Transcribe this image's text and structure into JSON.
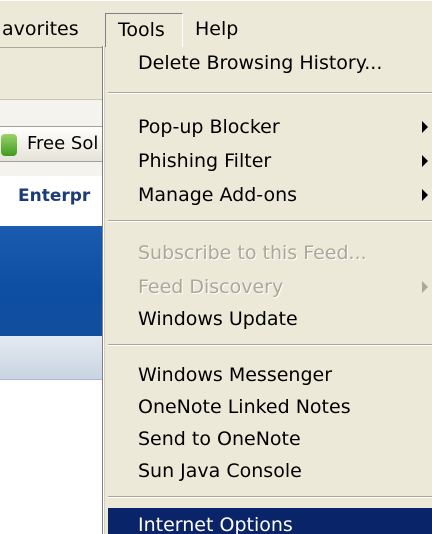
{
  "menubar": {
    "favorites_label": "avorites",
    "tools_label": "Tools",
    "help_label": "Help"
  },
  "background": {
    "toolbar_button_label": "Free Sol",
    "page_header_text": "Enterpr"
  },
  "tools_menu": {
    "items": [
      {
        "label": "Delete Browsing History...",
        "enabled": true,
        "submenu": false
      },
      {
        "label": "Pop-up Blocker",
        "enabled": true,
        "submenu": true
      },
      {
        "label": "Phishing Filter",
        "enabled": true,
        "submenu": true
      },
      {
        "label": "Manage Add-ons",
        "enabled": true,
        "submenu": true
      },
      {
        "label": "Subscribe to this Feed...",
        "enabled": false,
        "submenu": false
      },
      {
        "label": "Feed Discovery",
        "enabled": false,
        "submenu": true
      },
      {
        "label": "Windows Update",
        "enabled": true,
        "submenu": false
      },
      {
        "label": "Windows Messenger",
        "enabled": true,
        "submenu": false
      },
      {
        "label": "OneNote Linked Notes",
        "enabled": true,
        "submenu": false
      },
      {
        "label": "Send to OneNote",
        "enabled": true,
        "submenu": false
      },
      {
        "label": "Sun Java Console",
        "enabled": true,
        "submenu": false
      },
      {
        "label": "Internet Options",
        "enabled": true,
        "submenu": false,
        "highlighted": true
      }
    ]
  },
  "colors": {
    "menu_background": "#ece9d8",
    "selection_highlight": "#0a246a",
    "disabled_text": "#aca899",
    "page_banner_blue": "#1a5bb0"
  }
}
